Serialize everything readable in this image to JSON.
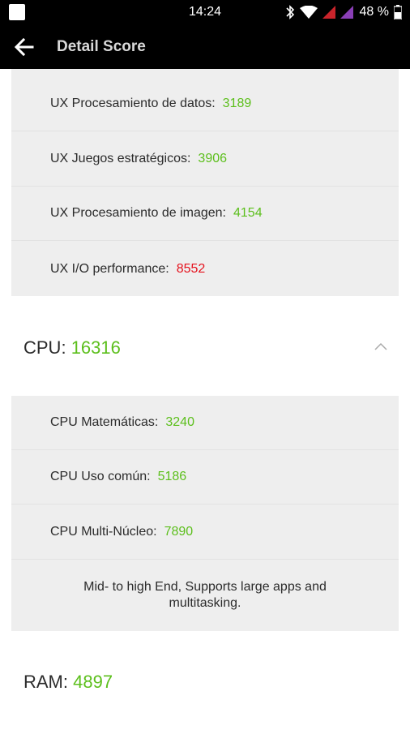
{
  "status_bar": {
    "time": "14:24",
    "battery_percent": "48 %",
    "icons": [
      "notification-square-icon",
      "bluetooth-icon",
      "wifi-icon",
      "signal-red-icon",
      "signal-purple-icon",
      "battery-icon"
    ]
  },
  "toolbar": {
    "title": "Detail Score",
    "back_icon": "arrow-left-icon"
  },
  "ux_items": [
    {
      "label": "UX Procesamiento de datos:",
      "value": "3189",
      "color": "#5cbf1c"
    },
    {
      "label": "UX Juegos estratégicos:",
      "value": "3906",
      "color": "#5cbf1c"
    },
    {
      "label": "UX Procesamiento de imagen:",
      "value": "4154",
      "color": "#5cbf1c"
    },
    {
      "label": "UX I/O performance:",
      "value": "8552",
      "color": "#e5121d"
    }
  ],
  "cpu": {
    "label": "CPU:",
    "score": "16316",
    "expanded": true,
    "items": [
      {
        "label": "CPU Matemáticas:",
        "value": "3240"
      },
      {
        "label": "CPU Uso común:",
        "value": "5186"
      },
      {
        "label": "CPU Multi-Núcleo:",
        "value": "7890"
      }
    ],
    "description": "Mid- to high End, Supports large apps and multitasking."
  },
  "ram": {
    "label": "RAM:",
    "score": "4897"
  },
  "colors": {
    "good": "#5cbf1c",
    "bad": "#e5121d",
    "panel_bg": "#eeeeee",
    "header_bg": "#000000"
  }
}
